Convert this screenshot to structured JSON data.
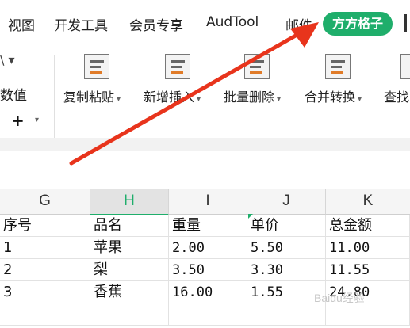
{
  "menu": {
    "tabs": [
      {
        "label": "视图"
      },
      {
        "label": "开发工具"
      },
      {
        "label": "会员专享"
      },
      {
        "label": "AudTool"
      },
      {
        "label": "邮件"
      },
      {
        "label": "方方格子",
        "active": true
      }
    ]
  },
  "ribbon": {
    "left_fragment_top": "\\ ▾",
    "left_fragment_bottom": "数值",
    "left_plus": "+",
    "buttons": [
      {
        "label": "复制粘贴",
        "icon": "clipboard-icon"
      },
      {
        "label": "新增插入",
        "icon": "insert-icon"
      },
      {
        "label": "批量删除",
        "icon": "delete-grid-icon"
      },
      {
        "label": "合并转换",
        "icon": "merge-convert-icon"
      },
      {
        "label": "查找",
        "icon": "find-icon"
      }
    ]
  },
  "sheet": {
    "columns": [
      "G",
      "H",
      "I",
      "J",
      "K"
    ],
    "selected_column": "H",
    "rows": [
      [
        "序号",
        "品名",
        "重量",
        "单价",
        "总金额"
      ],
      [
        "1",
        "苹果",
        "2.00",
        "5.50",
        "11.00"
      ],
      [
        "2",
        "梨",
        "3.50",
        "3.30",
        "11.55"
      ],
      [
        "3",
        "香蕉",
        "16.00",
        "1.55",
        "24.80"
      ]
    ]
  },
  "watermark": "Baidu经验",
  "colors": {
    "accent_green": "#1fae6b",
    "arrow_red": "#e8341c"
  }
}
